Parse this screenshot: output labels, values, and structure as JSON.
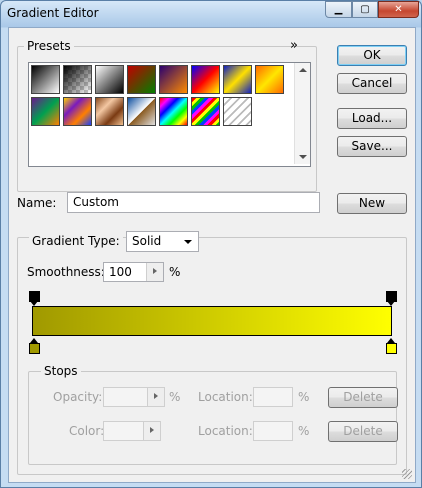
{
  "window": {
    "title": "Gradient Editor",
    "min_glyph": "▁",
    "max_glyph": "▢",
    "close_glyph": "✕"
  },
  "presets": {
    "label": "Presets",
    "menu_glyph": "»",
    "swatches": [
      {
        "name": "foreground-to-background",
        "css": "linear-gradient(135deg,#000,#fff)"
      },
      {
        "name": "foreground-to-transparent",
        "css": "linear-gradient(135deg,#000,rgba(0,0,0,0)),repeating-conic-gradient(#ccc 0 25%,#fff 0 50%) 0 0/8px 8px"
      },
      {
        "name": "black-white",
        "css": "linear-gradient(135deg,#fff,#000)"
      },
      {
        "name": "red-green",
        "css": "linear-gradient(135deg,#c00000,#008000)"
      },
      {
        "name": "violet-orange",
        "css": "linear-gradient(135deg,#2a006e,#ff8c00)"
      },
      {
        "name": "blue-red-yellow",
        "css": "linear-gradient(135deg,#0000ff,#ff0000,#ffff00)"
      },
      {
        "name": "blue-yellow-blue",
        "css": "linear-gradient(135deg,#1020c0,#ffe000,#1020c0)"
      },
      {
        "name": "orange-yellow-orange",
        "css": "linear-gradient(135deg,#ff6a00,#ffe600,#ff6a00)"
      },
      {
        "name": "violet-green-orange",
        "css": "linear-gradient(135deg,#6b1a8c,#00a050,#ff8000)"
      },
      {
        "name": "yellow-violet-orange-blue",
        "css": "linear-gradient(135deg,#ffd000,#7a1bbd,#ff7f00,#1840ff)"
      },
      {
        "name": "copper",
        "css": "linear-gradient(135deg,#8a4a1e,#f3c7a2,#7a3a12,#f0c090)"
      },
      {
        "name": "chrome",
        "css": "linear-gradient(135deg,#1050a0,#ffffff 50%,#8a5a20 51%,#e0e0e0)"
      },
      {
        "name": "spectrum",
        "css": "linear-gradient(135deg,#ff0000,#ff00ff,#0000ff,#00ffff,#00ff00,#ffff00,#ff0000)"
      },
      {
        "name": "transparent-rainbow",
        "css": "repeating-linear-gradient(135deg,#ff0000 0 3px,#ffff00 3px 6px,#00c000 6px 9px,#0040ff 9px 12px,#ff00ff 12px 15px)"
      },
      {
        "name": "transparent-stripes",
        "css": "repeating-linear-gradient(135deg,#fff 0 4px,#bbb 4px 6px)"
      }
    ]
  },
  "buttons": {
    "ok": "OK",
    "cancel": "Cancel",
    "load": "Load...",
    "save": "Save...",
    "new": "New"
  },
  "name_field": {
    "label": "Name:",
    "value": "Custom"
  },
  "gradient_type": {
    "label": "Gradient Type:",
    "value": "Solid"
  },
  "smoothness": {
    "label": "Smoothness:",
    "value": "100",
    "unit": "%"
  },
  "gradient": {
    "start_color": "#a09900",
    "end_color": "#ffff00",
    "opacity_stop_color": "#000000",
    "stops": [
      {
        "location": 0,
        "color": "#a09900"
      },
      {
        "location": 100,
        "color": "#ffff00"
      }
    ]
  },
  "stops_group": {
    "label": "Stops",
    "opacity_label": "Opacity:",
    "opacity_unit": "%",
    "location_label": "Location:",
    "location_unit": "%",
    "color_label": "Color:",
    "delete_label": "Delete"
  }
}
